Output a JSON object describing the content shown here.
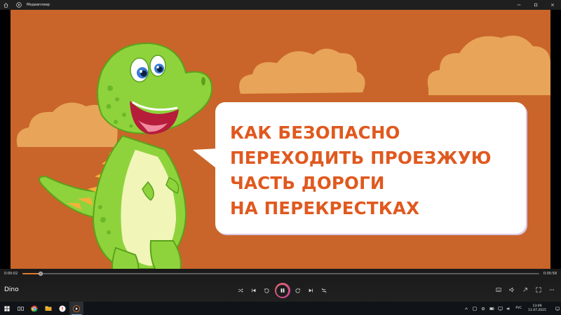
{
  "window": {
    "title": "Медиаплеер"
  },
  "video": {
    "headline_lines": [
      "КАК БЕЗОПАСНО",
      "ПЕРЕХОДИТЬ ПРОЕЗЖУЮ",
      "ЧАСТЬ ДОРОГИ",
      "НА ПЕРЕКРЕСТКАХ"
    ],
    "colors": {
      "background": "#c9652a",
      "cloud": "#e8a458",
      "headline": "#e0591f",
      "dino": "#8fd33c"
    }
  },
  "player": {
    "current_time": "0:00:02",
    "total_time": "0:00:58",
    "progress_fraction": 0.035,
    "media_title": "Dino",
    "accent": "#e07a2f"
  },
  "taskbar": {
    "language": "РУС",
    "time": "13:09",
    "date": "11.07.2025",
    "pinned_icons": [
      "task-view-icon",
      "chrome-icon",
      "file-explorer-icon",
      "yandex-browser-icon",
      "media-player-icon"
    ]
  }
}
